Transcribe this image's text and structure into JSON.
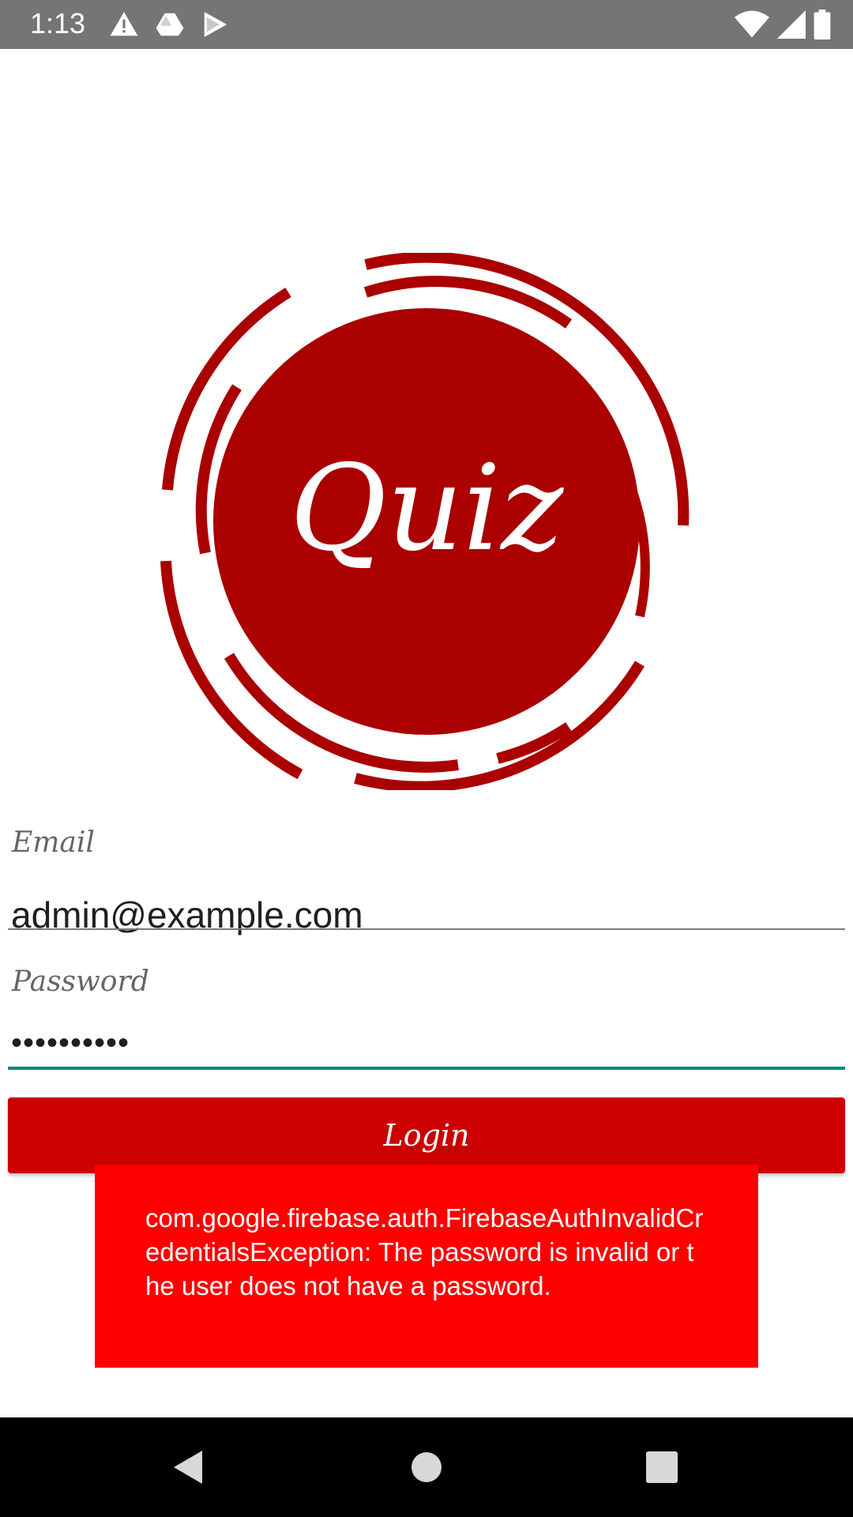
{
  "status_bar": {
    "time": "1:13",
    "left_icons": [
      "warning-icon",
      "drive-icon",
      "play-store-icon"
    ],
    "right_icons": [
      "wifi-icon",
      "signal-icon",
      "battery-icon"
    ]
  },
  "logo": {
    "text": "Quiz",
    "color": "#aa0000"
  },
  "form": {
    "email_label": "Email",
    "email_value": "admin@example.com",
    "password_label": "Password",
    "password_value": "••••••••••",
    "focused_underline_color": "#00897b"
  },
  "login_button": {
    "label": "Login",
    "color": "#cc0000"
  },
  "toast": {
    "message": "com.google.firebase.auth.FirebaseAuthInvalidCredentialsException: The password is invalid or the user does not have a password.",
    "background": "#ff0000"
  },
  "nav_bar": {
    "buttons": [
      "back-icon",
      "home-icon",
      "recents-icon"
    ]
  }
}
